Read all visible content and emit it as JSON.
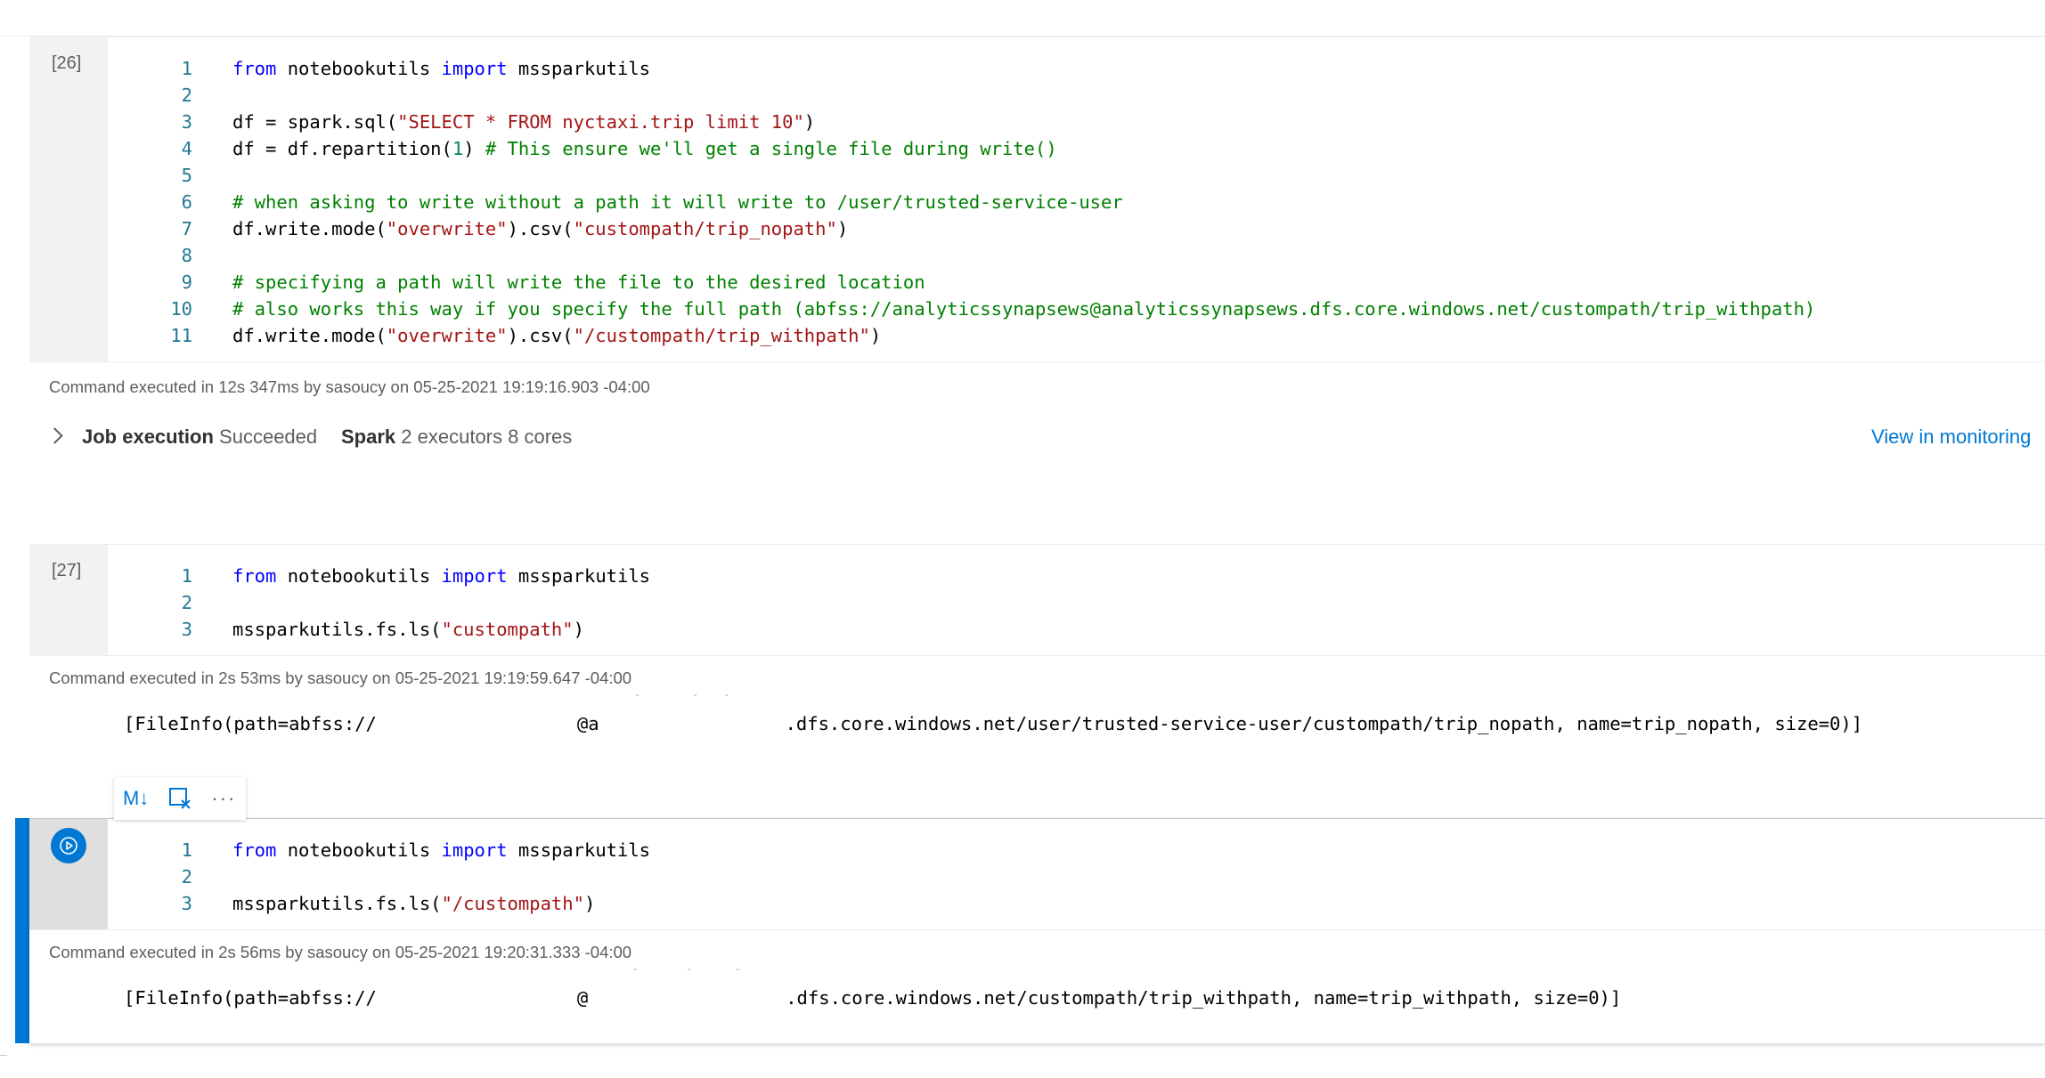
{
  "cells": [
    {
      "exec_count": "[26]",
      "lines": [
        {
          "n": "1",
          "tokens": [
            {
              "t": "kw",
              "v": "from"
            },
            {
              "t": "p",
              "v": " notebookutils "
            },
            {
              "t": "kw",
              "v": "import"
            },
            {
              "t": "p",
              "v": " mssparkutils"
            }
          ]
        },
        {
          "n": "2",
          "tokens": []
        },
        {
          "n": "3",
          "tokens": [
            {
              "t": "p",
              "v": "df = spark.sql("
            },
            {
              "t": "str",
              "v": "\"SELECT * FROM nyctaxi.trip limit 10\""
            },
            {
              "t": "p",
              "v": ")"
            }
          ]
        },
        {
          "n": "4",
          "tokens": [
            {
              "t": "p",
              "v": "df = df.repartition("
            },
            {
              "t": "num",
              "v": "1"
            },
            {
              "t": "p",
              "v": ") "
            },
            {
              "t": "cm",
              "v": "# This ensure we'll get a single file during write()"
            }
          ]
        },
        {
          "n": "5",
          "tokens": []
        },
        {
          "n": "6",
          "tokens": [
            {
              "t": "cm",
              "v": "# when asking to write without a path it will write to /user/trusted-service-user"
            }
          ]
        },
        {
          "n": "7",
          "tokens": [
            {
              "t": "p",
              "v": "df.write.mode("
            },
            {
              "t": "str",
              "v": "\"overwrite\""
            },
            {
              "t": "p",
              "v": ").csv("
            },
            {
              "t": "str",
              "v": "\"custompath/trip_nopath\""
            },
            {
              "t": "p",
              "v": ")"
            }
          ]
        },
        {
          "n": "8",
          "tokens": []
        },
        {
          "n": "9",
          "tokens": [
            {
              "t": "cm",
              "v": "# specifying a path will write the file to the desired location"
            }
          ]
        },
        {
          "n": "10",
          "tokens": [
            {
              "t": "cm",
              "v": "# also works this way if you specify the full path (abfss://analyticssynapsews@analyticssynapsews.dfs.core.windows.net/custompath/trip_withpath)"
            }
          ]
        },
        {
          "n": "11",
          "tokens": [
            {
              "t": "p",
              "v": "df.write.mode("
            },
            {
              "t": "str",
              "v": "\"overwrite\""
            },
            {
              "t": "p",
              "v": ").csv("
            },
            {
              "t": "str",
              "v": "\"/custompath/trip_withpath\""
            },
            {
              "t": "p",
              "v": ")"
            }
          ]
        }
      ],
      "status": "Command executed in 12s 347ms by sasoucy on 05-25-2021 19:19:16.903 -04:00",
      "job": {
        "label": "Job execution",
        "state": "Succeeded",
        "spark_label": "Spark",
        "spark_info": "2 executors 8 cores",
        "link": "View in monitoring"
      }
    },
    {
      "exec_count": "[27]",
      "lines": [
        {
          "n": "1",
          "tokens": [
            {
              "t": "kw",
              "v": "from"
            },
            {
              "t": "p",
              "v": " notebookutils "
            },
            {
              "t": "kw",
              "v": "import"
            },
            {
              "t": "p",
              "v": " mssparkutils"
            }
          ]
        },
        {
          "n": "2",
          "tokens": []
        },
        {
          "n": "3",
          "tokens": [
            {
              "t": "p",
              "v": "mssparkutils.fs.ls("
            },
            {
              "t": "str",
              "v": "\"custompath\""
            },
            {
              "t": "p",
              "v": ")"
            }
          ]
        }
      ],
      "status": "Command executed in 2s 53ms by sasoucy on 05-25-2021 19:19:59.647 -04:00",
      "output": {
        "prefix": "[FileInfo(path=abfss://",
        "at": "@a",
        "suffix": ".dfs.core.windows.net/user/trusted-service-user/custompath/trip_nopath, name=trip_nopath, size=0)]"
      }
    },
    {
      "exec_count": "",
      "lines": [
        {
          "n": "1",
          "tokens": [
            {
              "t": "kw",
              "v": "from"
            },
            {
              "t": "p",
              "v": " notebookutils "
            },
            {
              "t": "kw",
              "v": "import"
            },
            {
              "t": "p",
              "v": " mssparkutils"
            }
          ]
        },
        {
          "n": "2",
          "tokens": []
        },
        {
          "n": "3",
          "tokens": [
            {
              "t": "p",
              "v": "mssparkutils.fs.ls("
            },
            {
              "t": "str",
              "v": "\"/custompath\""
            },
            {
              "t": "p",
              "v": ")"
            }
          ]
        }
      ],
      "status": "Command executed in 2s 56ms by sasoucy on 05-25-2021 19:20:31.333 -04:00",
      "output": {
        "prefix": "[FileInfo(path=abfss://",
        "at": "@",
        "suffix": ".dfs.core.windows.net/custompath/trip_withpath, name=trip_withpath, size=0)]"
      }
    }
  ],
  "toolbar": {
    "markdown_label": "M↓",
    "more_label": "···"
  },
  "icons": {
    "run": "run-cell-icon",
    "markdown": "markdown-toggle-icon",
    "clear": "clear-output-icon",
    "more": "more-icon"
  },
  "colors": {
    "accent": "#0078d4",
    "keyword": "#0000ff",
    "string": "#a31515",
    "number": "#098658",
    "comment": "#008000",
    "line_number": "#237893"
  }
}
